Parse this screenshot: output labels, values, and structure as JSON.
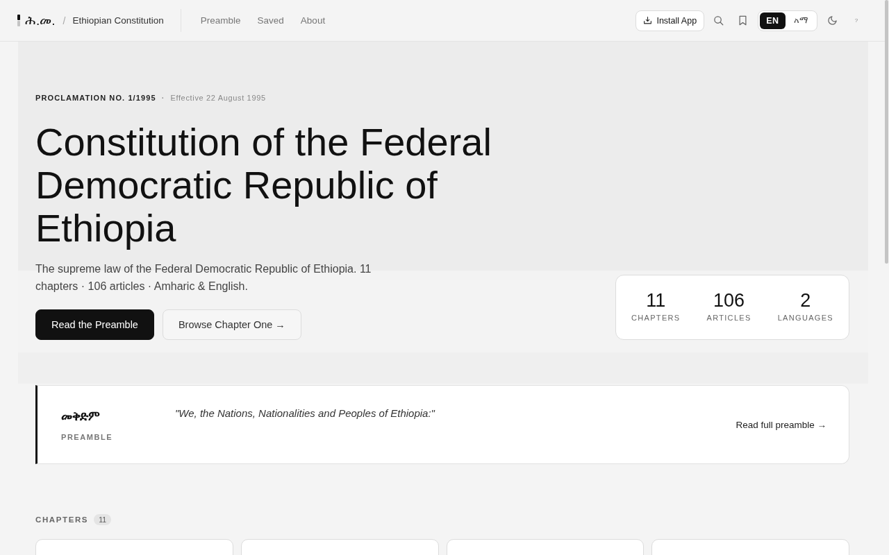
{
  "header": {
    "logo_text": "ሕ.መ.",
    "separator": "/",
    "site_title": "Ethiopian Constitution",
    "nav": [
      {
        "label": "Preamble",
        "selected": false
      },
      {
        "label": "Saved",
        "selected": false
      },
      {
        "label": "About",
        "selected": false
      }
    ],
    "install_button": "Install App",
    "languages": [
      {
        "label": "EN",
        "selected": true
      },
      {
        "label": "አማ",
        "selected": false
      }
    ],
    "help_button": "?"
  },
  "hero": {
    "proclamation": "PROCLAMATION NO. 1/1995",
    "separator": "·",
    "effective": "Effective 22 August 1995",
    "title": "Constitution of the Federal Democratic Republic of Ethiopia",
    "subtitle": "The supreme law of the Federal Democratic Republic of Ethiopia. 11 chapters · 106 articles · Amharic & English.",
    "buttons": [
      {
        "label": "Read the Preamble",
        "kind": "primary"
      },
      {
        "label": "Browse Chapter One →",
        "kind": "secondary"
      }
    ],
    "stats": [
      {
        "value": "11",
        "label": "CHAPTERS"
      },
      {
        "value": "106",
        "label": "ARTICLES"
      },
      {
        "value": "2",
        "label": "LANGUAGES"
      }
    ]
  },
  "preamble": {
    "title": "መቅድም",
    "label": "PREAMBLE",
    "quote": "\"We, the Nations, Nationalities and Peoples of Ethiopia:\"",
    "link": "Read full preamble →"
  },
  "chapters": {
    "heading": "CHAPTERS",
    "count": "11"
  }
}
